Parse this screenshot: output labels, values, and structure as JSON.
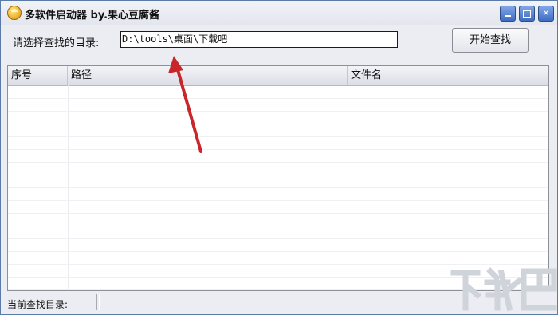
{
  "window": {
    "title": "多软件启动器 by.果心豆腐酱",
    "controls": {
      "minimize": "minimize",
      "maximize": "maximize",
      "close": "✕"
    }
  },
  "search": {
    "label": "请选择查找的目录:",
    "path_value": "D:\\tools\\桌面\\下载吧",
    "start_button": "开始查找"
  },
  "table": {
    "columns": [
      "序号",
      "路径",
      "文件名"
    ],
    "rows": []
  },
  "status": {
    "current_dir_label": "当前查找目录:"
  },
  "annotation": {
    "color": "#c8262b"
  },
  "watermark": {
    "text": "下载吧",
    "color": "#cfd3da"
  }
}
